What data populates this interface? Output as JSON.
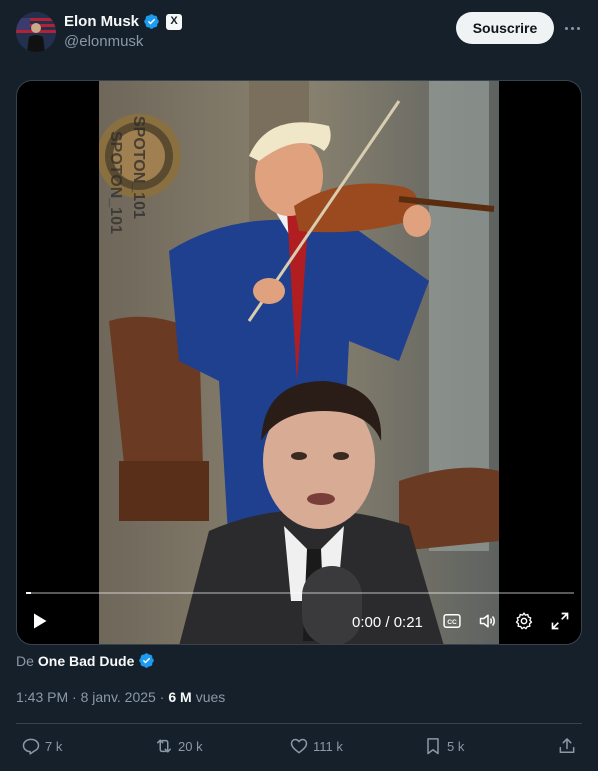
{
  "author": {
    "name": "Elon Musk",
    "handle": "@elonmusk",
    "x_badge": "X",
    "verified_color": "#1d9bf0"
  },
  "header": {
    "subscribe_label": "Souscrire",
    "more_icon": "more-horizontal-icon"
  },
  "video": {
    "watermark": "SPOTON_101",
    "time": "0:00 / 0:21",
    "progress": 0.01,
    "icons": [
      "play-icon",
      "captions-icon",
      "volume-icon",
      "settings-icon",
      "fullscreen-icon"
    ]
  },
  "source": {
    "prefix": "De",
    "name": "One Bad Dude"
  },
  "meta": {
    "time": "1:43 PM · 8 janv. 2025 ·",
    "views_count": "6 M",
    "views_label": "vues"
  },
  "actions": {
    "replies": "7 k",
    "reposts": "20 k",
    "likes": "111 k",
    "bookmarks": "5 k"
  },
  "colors": {
    "background": "#15202b",
    "secondary_text": "#8b98a5",
    "divider": "#38444d"
  }
}
